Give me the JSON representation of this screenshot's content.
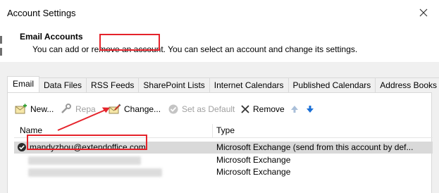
{
  "window": {
    "title": "Account Settings"
  },
  "header": {
    "section_title": "Email Accounts",
    "section_desc": "You can add or remove an account. You can select an account and change its settings."
  },
  "tabs": [
    {
      "label": "Email",
      "active": true
    },
    {
      "label": "Data Files"
    },
    {
      "label": "RSS Feeds"
    },
    {
      "label": "SharePoint Lists"
    },
    {
      "label": "Internet Calendars"
    },
    {
      "label": "Published Calendars"
    },
    {
      "label": "Address Books"
    }
  ],
  "toolbar": {
    "new_label": "New...",
    "repair_label": "Repa",
    "change_label": "Change...",
    "default_label": "Set as Default",
    "remove_label": "Remove",
    "icons": [
      "new-icon",
      "repair-icon",
      "change-icon",
      "set-default-icon",
      "remove-icon",
      "move-up-icon",
      "move-down-icon"
    ]
  },
  "list": {
    "col_name": "Name",
    "col_type": "Type",
    "rows": [
      {
        "name": "mandyzhou@extendoffice.com",
        "type": "Microsoft Exchange (send from this account by def...",
        "default": true,
        "selected": true
      },
      {
        "name": "",
        "type": "Microsoft Exchange",
        "name_obscured": true
      },
      {
        "name": "",
        "type": "Microsoft Exchange",
        "name_obscured": true
      }
    ]
  },
  "colors": {
    "annotation": "#e5232b",
    "accent_blue": "#1a6fd6",
    "panel_bg": "#f0f0f0"
  }
}
